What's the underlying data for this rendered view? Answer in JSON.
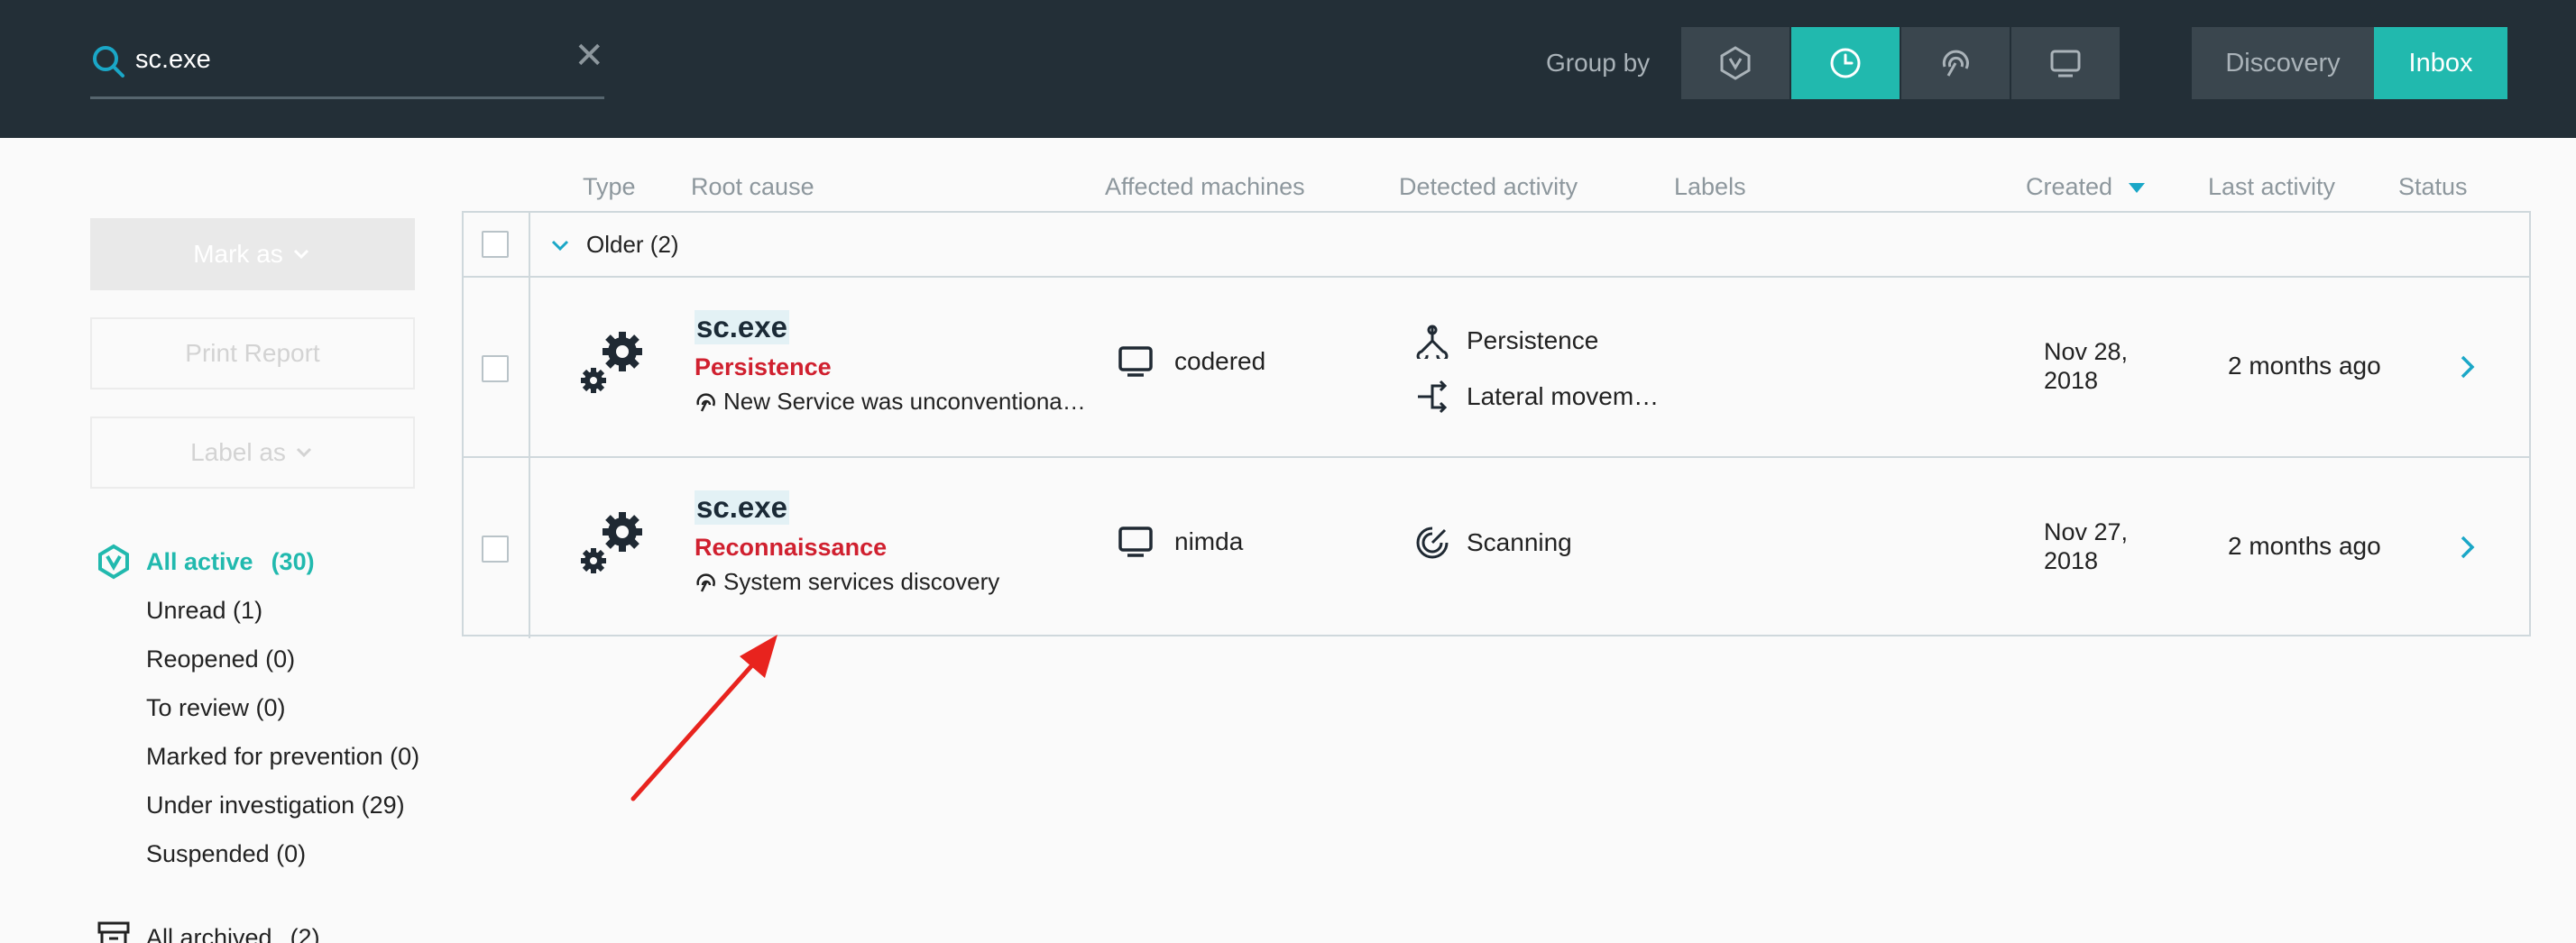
{
  "search": {
    "value": "sc.exe"
  },
  "header": {
    "groupby_label": "Group by",
    "groupby_icons": [
      "hexagon-icon",
      "clock-icon",
      "fingerprint-icon",
      "monitor-icon"
    ],
    "groupby_active": 1,
    "tabs": {
      "discovery": "Discovery",
      "inbox": "Inbox"
    }
  },
  "sidebar": {
    "mark_as": "Mark as",
    "print_report": "Print Report",
    "label_as": "Label as",
    "all_active": "All active",
    "all_active_count": "(30)",
    "filters": [
      "Unread (1)",
      "Reopened (0)",
      "To review (0)",
      "Marked for prevention (0)",
      "Under investigation (29)",
      "Suspended (0)"
    ],
    "all_archived": "All archived",
    "all_archived_count": "(2)"
  },
  "table": {
    "columns": {
      "type": "Type",
      "root_cause": "Root cause",
      "affected": "Affected machines",
      "detected": "Detected activity",
      "labels": "Labels",
      "created": "Created",
      "last_activity": "Last activity",
      "status": "Status"
    },
    "group_label": "Older (2)",
    "rows": [
      {
        "name": "sc.exe",
        "root_cause": "Persistence",
        "description": "New Service was unconventiona…",
        "machine": "codered",
        "activities": [
          "Persistence",
          "Lateral movem…"
        ],
        "created": "Nov 28, 2018",
        "last_activity": "2 months ago"
      },
      {
        "name": "sc.exe",
        "root_cause": "Reconnaissance",
        "description": "System services discovery",
        "machine": "nimda",
        "activities": [
          "Scanning"
        ],
        "created": "Nov 27, 2018",
        "last_activity": "2 months ago"
      }
    ]
  },
  "colors": {
    "accent": "#21b9ae",
    "header_bg": "#232f37",
    "root_cause": "#d0202f",
    "annotation_arrow": "#e8231e"
  }
}
